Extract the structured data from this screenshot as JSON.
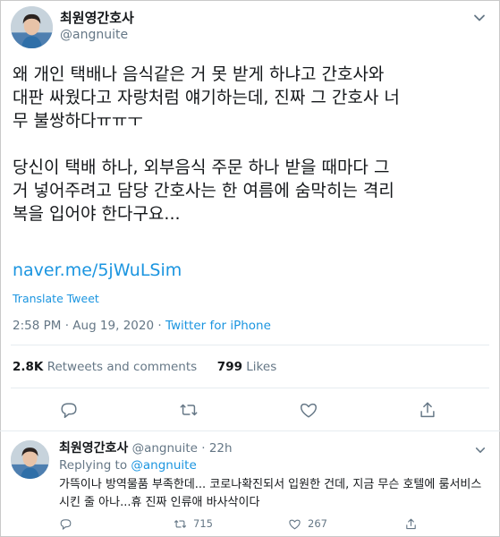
{
  "tweet": {
    "author_name": "최원영간호사",
    "author_handle": "@angnuite",
    "text": "왜 개인 택배나 음식같은 거 못 받게 하냐고 간호사와\n대판 싸웠다고 자랑처럼 얘기하는데, 진짜 그 간호사 너\n무 불쌍하다ㅠㅠㅜ\n\n당신이 택배 하나, 외부음식 주문 하나 받을 때마다 그\n거 넣어주려고 담당 간호사는 한 여름에 숨막히는 격리\n복을 입어야 한다구요...",
    "link": "naver.me/5jWuLSim",
    "translate_label": "Translate Tweet",
    "time": "2:58 PM",
    "date": "Aug 19, 2020",
    "source": "Twitter for iPhone",
    "separator": " · ",
    "retweets_count": "2.8K",
    "retweets_label": "Retweets and comments",
    "likes_count": "799",
    "likes_label": "Likes"
  },
  "reply": {
    "author_name": "최원영간호사",
    "author_handle": "@angnuite",
    "dot": "·",
    "age": "22h",
    "replying_label": "Replying to",
    "replying_to": "@angnuite",
    "text": "가뜩이나 방역물품 부족한데... 코로나확진되서 입원한 건데, 지금 무슨 호텔에 룸서비스 시킨 줄 아나...휴 진짜 인류애 바사삭이다",
    "retweets": "715",
    "likes": "267"
  },
  "icons": {
    "reply": "comment-icon",
    "retweet": "retweet-icon",
    "like": "heart-icon",
    "share": "share-icon",
    "more": "chevron-down-icon"
  },
  "colors": {
    "link": "#1b95e0",
    "secondary_text": "#657786",
    "primary_text": "#14171a"
  }
}
